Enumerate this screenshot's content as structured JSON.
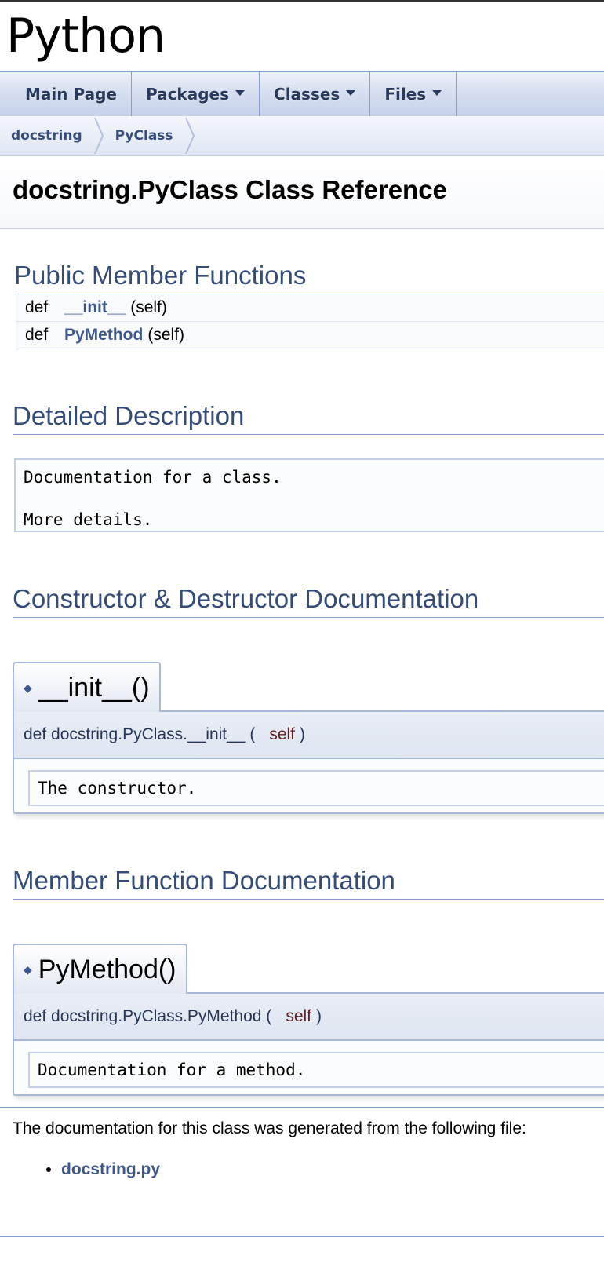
{
  "project": {
    "title": "Python"
  },
  "navbar": {
    "items": [
      {
        "label": "Main Page",
        "dropdown": false
      },
      {
        "label": "Packages",
        "dropdown": true
      },
      {
        "label": "Classes",
        "dropdown": true
      },
      {
        "label": "Files",
        "dropdown": true
      }
    ]
  },
  "breadcrumb": [
    "docstring",
    "PyClass"
  ],
  "page": {
    "title": "docstring.PyClass Class Reference"
  },
  "public_members": {
    "heading": "Public Member Functions",
    "rows": [
      {
        "keyword": "def",
        "name": "__init__",
        "args": "(self)"
      },
      {
        "keyword": "def",
        "name": "PyMethod",
        "args": "(self)"
      }
    ]
  },
  "detailed": {
    "heading": "Detailed Description",
    "lines": [
      "Documentation for a class.",
      "More details."
    ]
  },
  "constructor": {
    "heading": "Constructor & Destructor Documentation",
    "title": "__init__()",
    "proto_prefix": "def docstring.PyClass.__init__ (",
    "param": "self",
    "proto_suffix": ")",
    "doc": "The constructor."
  },
  "member_doc": {
    "heading": "Member Function Documentation",
    "title": "PyMethod()",
    "proto_prefix": "def docstring.PyClass.PyMethod (",
    "param": "self",
    "proto_suffix": ")",
    "doc": "Documentation for a method."
  },
  "footer": {
    "text": "The documentation for this class was generated from the following file:",
    "files": [
      "docstring.py"
    ]
  },
  "colors": {
    "link": "#3d578c",
    "heading": "#354c7b",
    "border": "#a8b8d9",
    "param": "#602020"
  }
}
